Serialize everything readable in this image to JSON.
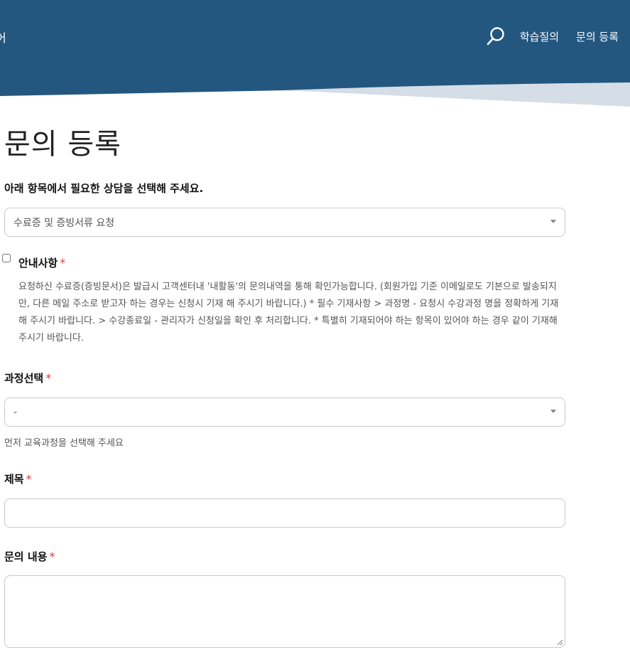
{
  "header": {
    "brand_fragment": "어",
    "nav": {
      "study_qna": "학습질의",
      "register_inquiry": "문의 등록"
    },
    "colors": {
      "primary": "#23577f",
      "wave": "#d5dee6"
    }
  },
  "page": {
    "title": "문의 등록",
    "subtitle": "아래 항목에서 필요한 상담을 선택해 주세요.",
    "category_select": {
      "value": "수료증 및 증빙서류 요청"
    },
    "notice": {
      "label": "안내사항",
      "required_mark": "*",
      "body": "요청하신 수료증(증빙문서)은 발급시 고객센터내 '내활동'의 문의내역을 통해 확인가능합니다. (회원가입 기준 이메일로도 기본으로 발송되지만, 다른 메일 주소로 받고자 하는 경우는 신청시 기재 해 주시기 바랍니다.) * 필수 기재사항 > 과정명 - 요청시 수강과정 명을 정확하게 기재해 주시기 바랍니다. > 수강종료일 - 관리자가 신청일을 확인 후 처리합니다. * 특별히 기재되어야 하는 항목이 있어야 하는 경우 같이 기재해 주시기 바랍니다."
    },
    "course": {
      "label": "과정선택",
      "required_mark": "*",
      "value": "-",
      "helper": "먼저 교육과정을 선택해 주세요"
    },
    "subject": {
      "label": "제목",
      "required_mark": "*",
      "value": ""
    },
    "content": {
      "label": "문의 내용",
      "required_mark": "*",
      "value": ""
    }
  }
}
